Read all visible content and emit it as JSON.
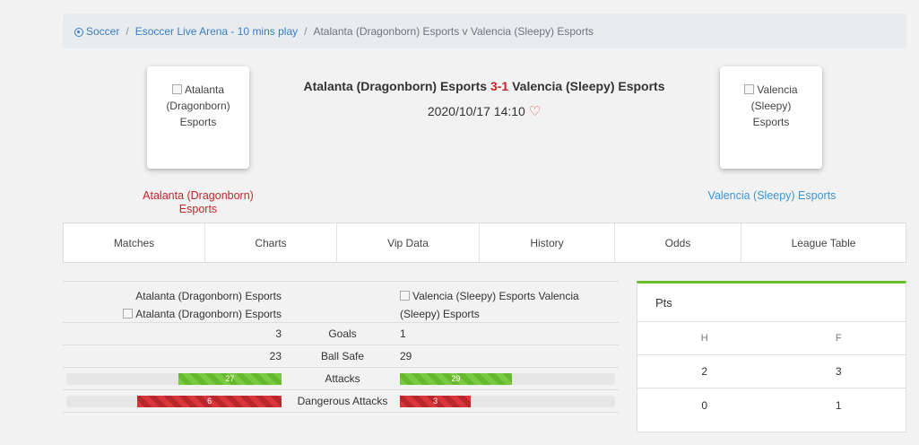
{
  "breadcrumb": {
    "items": [
      "Soccer",
      "Esoccer Live Arena - 10 mins play"
    ],
    "current": "Atalanta (Dragonborn) Esports v Valencia (Sleepy) Esports"
  },
  "match": {
    "home_team": "Atalanta (Dragonborn) Esports",
    "away_team": "Valencia (Sleepy) Esports",
    "score": "3-1",
    "date": "2020/10/17 14:10",
    "home_logo_alt": "Atalanta (Dragonborn) Esports",
    "away_logo_alt": "Valencia (Sleepy) Esports"
  },
  "tabs": [
    "Matches",
    "Charts",
    "Vip Data",
    "History",
    "Odds",
    "League Table"
  ],
  "stats": {
    "home_header": "Atalanta (Dragonborn) Esports",
    "home_img_alt": "Atalanta (Dragonborn) Esports",
    "away_img_alt": "Valencia (Sleepy) Esports",
    "away_header": "Valencia (Sleepy) Esports",
    "rows": [
      {
        "label": "Goals",
        "home": "3",
        "away": "1"
      },
      {
        "label": "Ball Safe",
        "home": "23",
        "away": "29"
      }
    ],
    "bars": [
      {
        "label": "Attacks",
        "home": "27",
        "away": "29",
        "home_frac": 0.48,
        "away_frac": 0.52,
        "color": "#7ac943"
      },
      {
        "label": "Dangerous Attacks",
        "home": "6",
        "away": "3",
        "home_frac": 0.67,
        "away_frac": 0.33,
        "color": "#d9363c"
      }
    ]
  },
  "pts": {
    "title": "Pts",
    "headers": [
      "H",
      "F"
    ],
    "rows": [
      [
        "2",
        "3"
      ],
      [
        "0",
        "1"
      ]
    ],
    "accent": "#6cbf2c"
  }
}
